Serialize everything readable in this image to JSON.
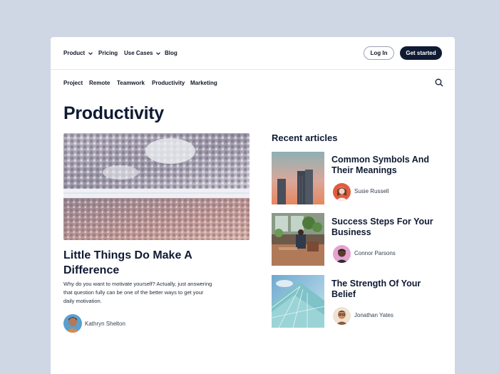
{
  "nav": {
    "product_label": "Product",
    "pricing_label": "Pricing",
    "use_cases_label": "Use Cases",
    "blog_label": "Blog",
    "login_label": "Log In",
    "get_started_label": "Get started"
  },
  "subnav": {
    "items": [
      "Project",
      "Remote",
      "Teamwork",
      "Productivity",
      "Marketing"
    ]
  },
  "page": {
    "title": "Productivity"
  },
  "featured": {
    "title": "Little Things Do Make A Difference",
    "excerpt": "Why do you want to motivate yourself? Actually, just answering that question fully can be one of the better ways to get your daily motivation.",
    "author": "Kathryn Shelton"
  },
  "recent": {
    "heading": "Recent articles",
    "articles": [
      {
        "title": "Common Symbols And Their Meanings",
        "author": "Susie Russell"
      },
      {
        "title": "Success Steps For Your Business",
        "author": "Connor Parsons"
      },
      {
        "title": "The Strength Of Your Belief",
        "author": "Jonathan Yates"
      }
    ]
  },
  "colors": {
    "background": "#cfd6e4",
    "primary_dark": "#0f1a33",
    "text": "#111827"
  }
}
